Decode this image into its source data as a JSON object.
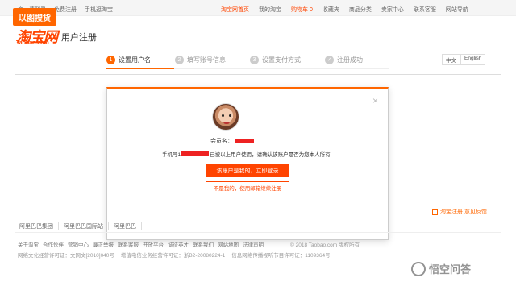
{
  "badge": {
    "text": "以图搜货"
  },
  "topbar": {
    "left_links": [
      "亲，请登录",
      "免费注册",
      "手机逛淘宝"
    ],
    "right_links": [
      "淘宝网首页",
      "我的淘宝",
      "购物车 0",
      "收藏夹",
      "商品分类",
      "卖家中心",
      "联系客服",
      "网站导航"
    ],
    "cart_highlight_index": 0
  },
  "logo": {
    "cn": "淘宝网",
    "en": "Taobao.com"
  },
  "page_title": "用户注册",
  "steps": [
    {
      "num": "1",
      "label": "设置用户名",
      "active": true
    },
    {
      "num": "2",
      "label": "填写账号信息",
      "active": false
    },
    {
      "num": "3",
      "label": "设置支付方式",
      "active": false
    },
    {
      "num": "✓",
      "label": "注册成功",
      "active": false
    }
  ],
  "lang": [
    "中文",
    "English"
  ],
  "modal": {
    "close": "×",
    "member_prefix": "会员名：",
    "message_prefix": "手机号1",
    "message_suffix": "已被以上用户使用，请确认该账户是否为您本人所有",
    "login_button": "该账户是我的，立即登录",
    "other_button": "不是我的，使用邮箱继续注册"
  },
  "footer": {
    "tabs": [
      "阿里巴巴集团",
      "阿里巴巴国际站",
      "阿里巴巴"
    ],
    "feedback": "淘宝注册 意见反馈",
    "links": [
      "关于淘宝",
      "合作伙伴",
      "营销中心",
      "廉正举报",
      "联系客服",
      "开放平台",
      "诚征英才",
      "联系我们",
      "网站地图",
      "法律声明"
    ],
    "copyright": "© 2018 Taobao.com 版权所有",
    "license": [
      "网络文化经营许可证：文网文[2010]040号",
      "增值电信业务经营许可证：浙B2-20080224-1",
      "信息网络传播视听节目许可证：1109364号"
    ]
  },
  "watermark": "悟空问答",
  "colors": {
    "accent": "#ff4400",
    "badge": "#ff6600"
  }
}
